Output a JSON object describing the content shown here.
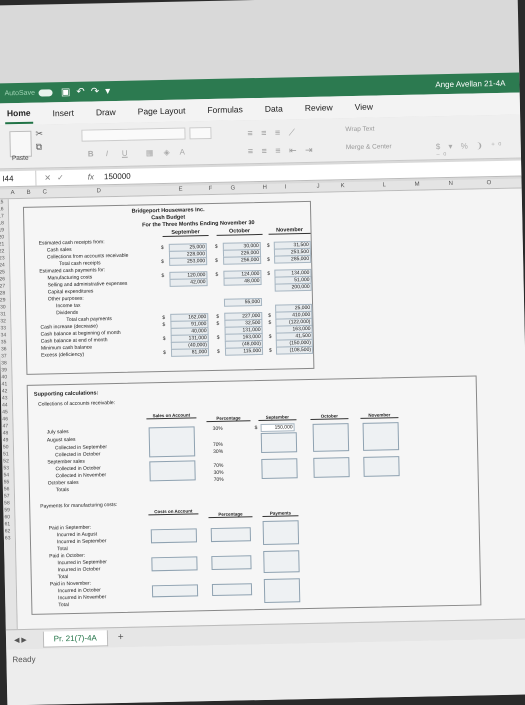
{
  "titlebar": {
    "autosave": "AutoSave",
    "user": "Ange Avellan 21-4A"
  },
  "tabs": [
    "Home",
    "Insert",
    "Draw",
    "Page Layout",
    "Formulas",
    "Data",
    "Review",
    "View"
  ],
  "ribbon": {
    "paste": "Paste",
    "wrap_text": "Wrap Text",
    "merge_center": "Merge & Center"
  },
  "formula_bar": {
    "name_box": "I44",
    "fx": "fx",
    "value": "150000"
  },
  "columns": [
    "A",
    "B",
    "C",
    "D",
    "E",
    "F",
    "G",
    "H",
    "I",
    "J",
    "K",
    "L",
    "M",
    "N",
    "O"
  ],
  "rows": [
    "15",
    "16",
    "17",
    "18",
    "19",
    "20",
    "21",
    "22",
    "23",
    "24",
    "25",
    "26",
    "27",
    "28",
    "29",
    "30",
    "31",
    "32",
    "33",
    "34",
    "35",
    "36",
    "37",
    "38",
    "39",
    "40",
    "41",
    "42",
    "43",
    "44",
    "45",
    "46",
    "47",
    "48",
    "49",
    "50",
    "51",
    "52",
    "53",
    "54",
    "55",
    "56",
    "57",
    "58",
    "59",
    "60",
    "61",
    "62",
    "63"
  ],
  "budget": {
    "company": "Bridgeport Housewares Inc.",
    "title": "Cash Budget",
    "period": "For the Three Months Ending November 30",
    "months": [
      "September",
      "October",
      "November"
    ],
    "labels": {
      "receipts_from": "Estimated cash receipts from:",
      "cash_sales": "Cash sales",
      "collections": "Collections from accounts receivable",
      "total_receipts": "Total cash receipts",
      "payments_for": "Estimated cash payments for:",
      "manufacturing": "Manufacturing costs",
      "selling": "Selling and administrative expenses",
      "capital": "Capital expenditures",
      "other": "Other purposes:",
      "income_tax": "Income tax",
      "dividends": "Dividends",
      "total_payments": "Total cash payments",
      "increase": "Cash increase (decrease)",
      "beginning": "Cash balance at beginning of month",
      "end": "Cash balance at end of month",
      "minimum": "Minimum cash balance",
      "excess": "Excess (deficiency)"
    },
    "currency": "$",
    "sep": {
      "cash_sales": "25,000",
      "collections": "228,000",
      "total_receipts": "253,000",
      "manufacturing": "120,000",
      "selling": "42,000",
      "increase": "91,000",
      "beginning": "40,000",
      "end": "131,000",
      "minimum": "(40,000)",
      "excess": "81,000",
      "total_payments": "162,000"
    },
    "oct": {
      "cash_sales": "30,000",
      "collections": "226,000",
      "total_receipts": "256,000",
      "manufacturing": "124,000",
      "selling": "48,000",
      "income_tax": "55,000",
      "total_payments": "227,000",
      "increase": "32,500",
      "beginning": "131,000",
      "end": "163,000",
      "minimum": "(48,000)",
      "excess": "115,000"
    },
    "nov": {
      "cash_sales": "31,500",
      "collections": "253,500",
      "total_receipts": "285,000",
      "manufacturing": "134,000",
      "selling": "51,000",
      "capital": "200,000",
      "dividends": "25,000",
      "total_payments": "410,000",
      "increase": "(122,000)",
      "beginning": "163,000",
      "end": "41,500",
      "minimum": "(150,000)",
      "excess": "(108,500)"
    }
  },
  "support": {
    "title": "Supporting calculations:",
    "collections_title": "Collections of accounts receivable:",
    "sales_on_account": "Sales on Account",
    "percentage": "Percentage",
    "months": [
      "September",
      "October",
      "November"
    ],
    "rows": [
      "July sales",
      "August sales",
      "Collected in September",
      "Collected in October",
      "September sales",
      "Collected in October",
      "Collected in November",
      "October sales",
      "Totals"
    ],
    "pcts": [
      "30%",
      "70%",
      "30%",
      "70%",
      "30%",
      "70%"
    ],
    "sep_value": "150,000",
    "currency": "$",
    "payments_title": "Payments for manufacturing costs:",
    "costs_on_account": "Costs on Account",
    "payments": "Payments",
    "pay_rows": [
      "Paid in September:",
      "Incurred in August",
      "Incurred in September",
      "Total",
      "Paid in October:",
      "Incurred in September",
      "Incurred in October",
      "Total",
      "Paid in November:",
      "Incurred in October",
      "Incurred in November",
      "Total"
    ]
  },
  "sheet_tab": "Pr. 21(7)-4A",
  "status": "Ready"
}
